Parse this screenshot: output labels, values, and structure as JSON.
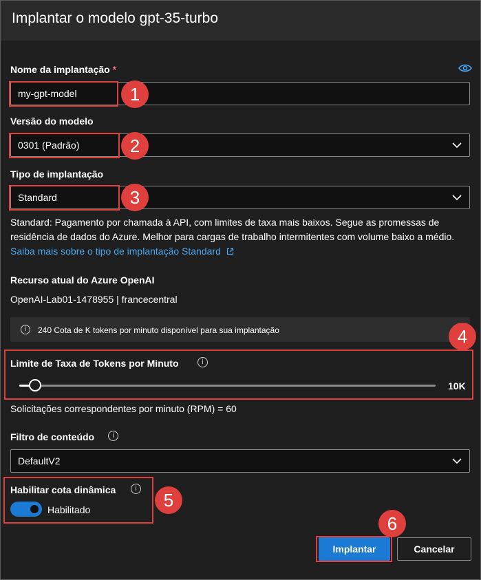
{
  "dialog": {
    "title": "Implantar o modelo gpt-35-turbo"
  },
  "deployment_name": {
    "label": "Nome da implantação",
    "required_mark": "*",
    "value": "my-gpt-model"
  },
  "model_version": {
    "label": "Versão do modelo",
    "value": "0301 (Padrão)"
  },
  "deployment_type": {
    "label": "Tipo de implantação",
    "value": "Standard",
    "description": "Standard: Pagamento por chamada à API, com limites de taxa mais baixos. Segue as promessas de residência de dados do Azure. Melhor para cargas de trabalho intermitentes com volume baixo a médio.",
    "learn_more": "Saiba mais sobre o tipo de implantação Standard"
  },
  "resource": {
    "label": "Recurso atual do Azure OpenAI",
    "value": "OpenAI-Lab01-1478955 | francecentral"
  },
  "quota_info": {
    "text": "240 Cota de K tokens por minuto disponível para sua implantação"
  },
  "rate_limit": {
    "label": "Limite de Taxa de Tokens por Minuto",
    "value_label": "10K",
    "slider_level": 0.03,
    "rpm_text": "Solicitações correspondentes por minuto (RPM) = 60"
  },
  "content_filter": {
    "label": "Filtro de conteúdo",
    "value": "DefaultV2"
  },
  "dynamic_quota": {
    "label": "Habilitar cota dinâmica",
    "toggle_state": "Habilitado",
    "enabled": true
  },
  "buttons": {
    "deploy": "Implantar",
    "cancel": "Cancelar"
  },
  "annotations": [
    "1",
    "2",
    "3",
    "4",
    "5",
    "6"
  ],
  "colors": {
    "background": "#1f1f1f",
    "title_bar": "#2b2b2b",
    "accent": "#1a7ad4",
    "link": "#4aa8f0",
    "annotation": "#e0403d",
    "required": "#f1707b"
  },
  "icons": {
    "reveal": "eye-icon",
    "dropdown": "chevron-down-icon",
    "info": "info-icon",
    "external": "external-link-icon"
  }
}
